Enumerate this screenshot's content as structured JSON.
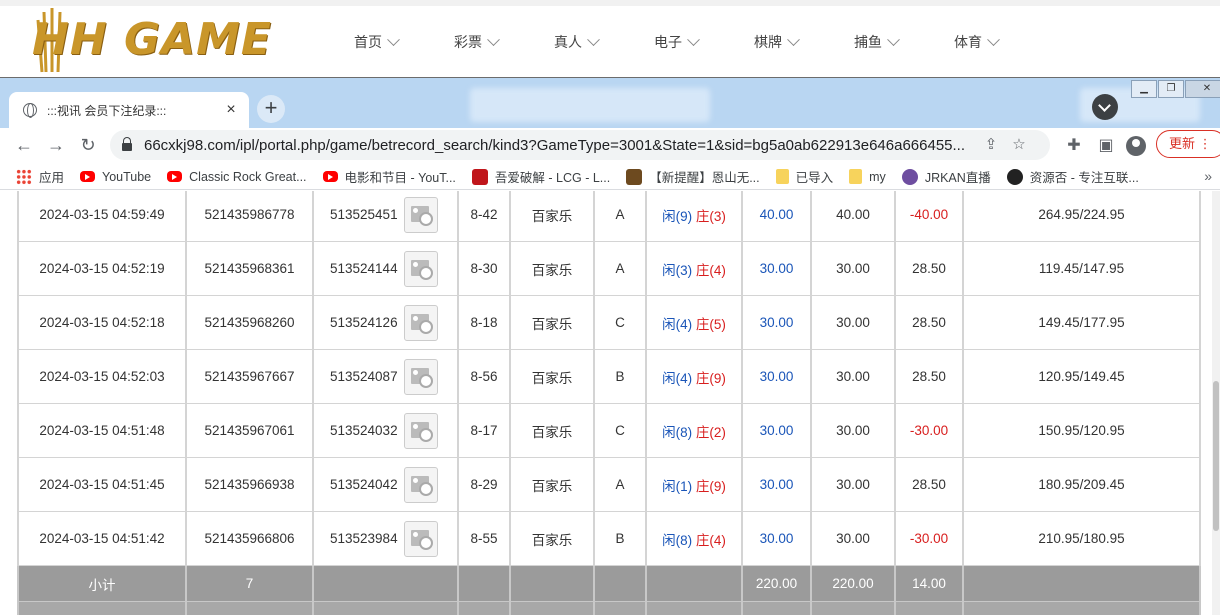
{
  "site": {
    "logo_text": "HH GAME",
    "nav": [
      {
        "label": "首页"
      },
      {
        "label": "彩票"
      },
      {
        "label": "真人"
      },
      {
        "label": "电子"
      },
      {
        "label": "棋牌"
      },
      {
        "label": "捕鱼"
      },
      {
        "label": "体育"
      }
    ]
  },
  "browser": {
    "tab_title": ":::视讯 会员下注纪录:::",
    "tab_close": "×",
    "new_tab": "+",
    "url": "66cxkj98.com/ipl/portal.php/game/betrecord_search/kind3?GameType=3001&State=1&sid=bg5a0ab622913e646a666455...",
    "update_label": "更新",
    "bookmarks": [
      {
        "label": "应用",
        "icon": "apps"
      },
      {
        "label": "YouTube",
        "icon": "yt"
      },
      {
        "label": "Classic Rock Great...",
        "icon": "yt"
      },
      {
        "label": "电影和节目 - YouT...",
        "icon": "yt"
      },
      {
        "label": "吾爱破解 - LCG - L...",
        "icon": "red"
      },
      {
        "label": "【新提醒】恩山无...",
        "icon": "brown"
      },
      {
        "label": "已导入",
        "icon": "folder"
      },
      {
        "label": "my",
        "icon": "folder"
      },
      {
        "label": "JRKAN直播",
        "icon": "purple"
      },
      {
        "label": "资源否 - 专注互联...",
        "icon": "dark"
      }
    ],
    "bookmarks_more": "»"
  },
  "records": [
    {
      "time": "2024-03-15 04:59:49",
      "bet_id": "521435986778",
      "round": "513525451",
      "table": "8-42",
      "game": "百家乐",
      "seat": "A",
      "player_label": "闲",
      "player": "(9)",
      "banker_label": "庄",
      "banker": "(3)",
      "bet": "40.00",
      "valid": "40.00",
      "win": "-40.00",
      "balance": "264.95/224.95"
    },
    {
      "time": "2024-03-15 04:52:19",
      "bet_id": "521435968361",
      "round": "513524144",
      "table": "8-30",
      "game": "百家乐",
      "seat": "A",
      "player_label": "闲",
      "player": "(3)",
      "banker_label": "庄",
      "banker": "(4)",
      "bet": "30.00",
      "valid": "30.00",
      "win": "28.50",
      "balance": "119.45/147.95"
    },
    {
      "time": "2024-03-15 04:52:18",
      "bet_id": "521435968260",
      "round": "513524126",
      "table": "8-18",
      "game": "百家乐",
      "seat": "C",
      "player_label": "闲",
      "player": "(4)",
      "banker_label": "庄",
      "banker": "(5)",
      "bet": "30.00",
      "valid": "30.00",
      "win": "28.50",
      "balance": "149.45/177.95"
    },
    {
      "time": "2024-03-15 04:52:03",
      "bet_id": "521435967667",
      "round": "513524087",
      "table": "8-56",
      "game": "百家乐",
      "seat": "B",
      "player_label": "闲",
      "player": "(4)",
      "banker_label": "庄",
      "banker": "(9)",
      "bet": "30.00",
      "valid": "30.00",
      "win": "28.50",
      "balance": "120.95/149.45"
    },
    {
      "time": "2024-03-15 04:51:48",
      "bet_id": "521435967061",
      "round": "513524032",
      "table": "8-17",
      "game": "百家乐",
      "seat": "C",
      "player_label": "闲",
      "player": "(8)",
      "banker_label": "庄",
      "banker": "(2)",
      "bet": "30.00",
      "valid": "30.00",
      "win": "-30.00",
      "balance": "150.95/120.95"
    },
    {
      "time": "2024-03-15 04:51:45",
      "bet_id": "521435966938",
      "round": "513524042",
      "table": "8-29",
      "game": "百家乐",
      "seat": "A",
      "player_label": "闲",
      "player": "(1)",
      "banker_label": "庄",
      "banker": "(9)",
      "bet": "30.00",
      "valid": "30.00",
      "win": "28.50",
      "balance": "180.95/209.45"
    },
    {
      "time": "2024-03-15 04:51:42",
      "bet_id": "521435966806",
      "round": "513523984",
      "table": "8-55",
      "game": "百家乐",
      "seat": "B",
      "player_label": "闲",
      "player": "(8)",
      "banker_label": "庄",
      "banker": "(4)",
      "bet": "30.00",
      "valid": "30.00",
      "win": "-30.00",
      "balance": "210.95/180.95"
    }
  ],
  "subtotal": {
    "label": "小计",
    "count": "7",
    "bet": "220.00",
    "valid": "220.00",
    "win": "14.00"
  },
  "colors": {
    "player": "#1a55b8",
    "banker": "#d81e1e",
    "negative": "#d81e1e",
    "subtotal_bg": "#9b9b9b",
    "logo_gold": "#c9962a"
  }
}
